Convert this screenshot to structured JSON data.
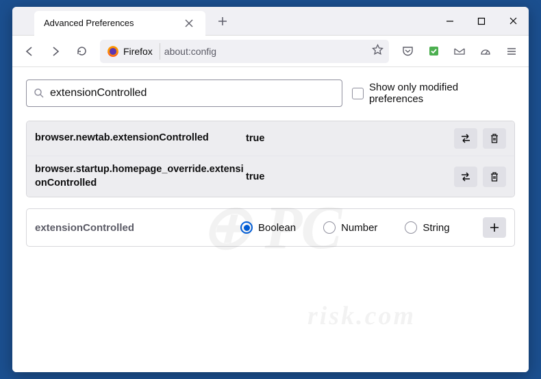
{
  "tab": {
    "title": "Advanced Preferences"
  },
  "urlbar": {
    "identity": "Firefox",
    "url": "about:config"
  },
  "search": {
    "value": "extensionControlled",
    "show_only_modified": "Show only modified preferences"
  },
  "prefs": [
    {
      "name": "browser.newtab.extensionControlled",
      "value": "true"
    },
    {
      "name": "browser.startup.homepage_override.extensionControlled",
      "value": "true"
    }
  ],
  "new_pref": {
    "name": "extensionControlled",
    "types": [
      "Boolean",
      "Number",
      "String"
    ],
    "selected": "Boolean"
  }
}
